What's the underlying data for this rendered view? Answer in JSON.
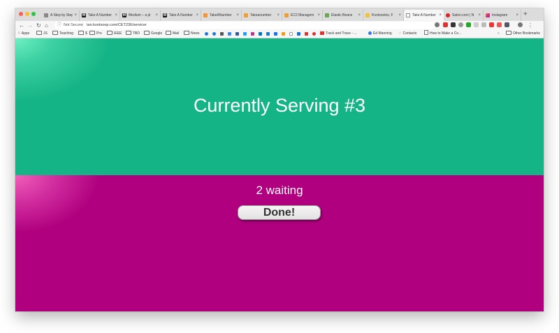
{
  "colors": {
    "serving_bg": "#15b486",
    "queue_bg": "#b0007f",
    "text_on_color": "#ffffff"
  },
  "browser": {
    "tabs": [
      {
        "title": "A Step by Step",
        "icon": "text-document-icon",
        "active": false
      },
      {
        "title": "Take A Number",
        "icon": "medium-m-icon",
        "active": false
      },
      {
        "title": "Medium – a pl",
        "icon": "medium-m-icon",
        "active": false
      },
      {
        "title": "Take A Number",
        "icon": "medium-m-icon",
        "active": false
      },
      {
        "title": "TakeANumber",
        "icon": "gitlab-fox-icon",
        "active": false
      },
      {
        "title": "Takeanumber",
        "icon": "orange-cube-icon",
        "active": false
      },
      {
        "title": "EC2 Managem",
        "icon": "orange-cube-icon",
        "active": false
      },
      {
        "title": "Elastic Beans",
        "icon": "beanstalk-icon",
        "active": false
      },
      {
        "title": "Kootsoolos, F",
        "icon": "yellow-lock-icon",
        "active": false
      },
      {
        "title": "Take A Number",
        "icon": "blank-page-icon",
        "active": true
      },
      {
        "title": "Salon.com | N",
        "icon": "red-circle-icon",
        "active": false
      },
      {
        "title": "Instagram",
        "icon": "instagram-icon",
        "active": false
      }
    ],
    "address": {
      "security_label": "Not Secure",
      "separator": "|",
      "url": "tan.kootsoop.com/CET236/servicer"
    },
    "bookmarks": [
      {
        "label": "Apps",
        "kind": "apps"
      },
      {
        "label": "JS",
        "kind": "folder"
      },
      {
        "label": "Teaching",
        "kind": "folder"
      },
      {
        "label": "$",
        "kind": "folder"
      },
      {
        "label": "Pro",
        "kind": "folder"
      },
      {
        "label": "IEEE",
        "kind": "folder"
      },
      {
        "label": "TBD",
        "kind": "folder"
      },
      {
        "label": "Google",
        "kind": "folder"
      },
      {
        "label": "Mail",
        "kind": "folder"
      },
      {
        "label": "News",
        "kind": "folder"
      },
      {
        "label": "Track and Trace - ...",
        "kind": "site"
      },
      {
        "label": "Ed Manning",
        "kind": "site"
      },
      {
        "label": "Contacts",
        "kind": "site"
      },
      {
        "label": "How to Make a Co...",
        "kind": "site"
      }
    ],
    "overflow_label": "»",
    "other_bookmarks": "Other Bookmarks"
  },
  "page": {
    "serving_text": "Currently Serving #3",
    "waiting_text": "2 waiting",
    "done_label": "Done!"
  }
}
